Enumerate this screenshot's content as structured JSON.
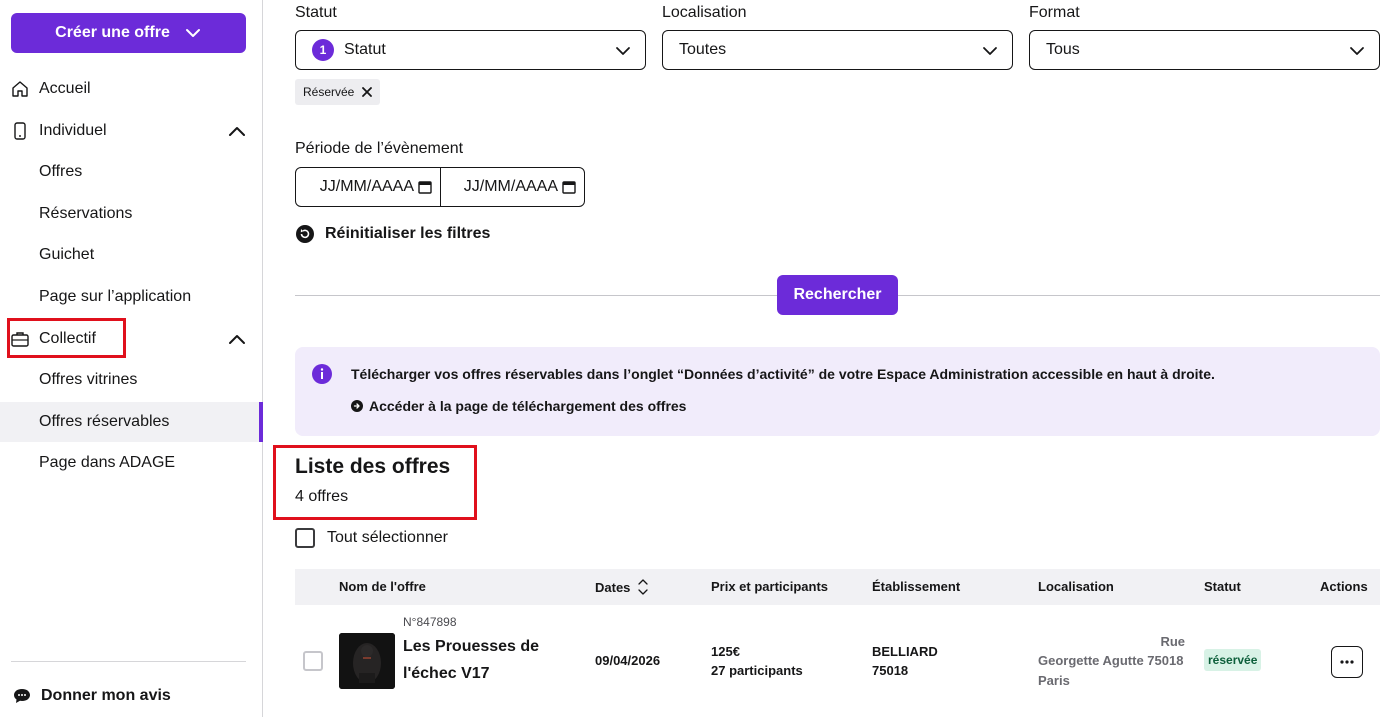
{
  "sidebar": {
    "create_button": "Créer une offre",
    "items": [
      {
        "label": "Accueil"
      },
      {
        "label": "Individuel"
      },
      {
        "label": "Offres"
      },
      {
        "label": "Réservations"
      },
      {
        "label": "Guichet"
      },
      {
        "label": "Page sur l’application"
      },
      {
        "label": "Collectif"
      },
      {
        "label": "Offres vitrines"
      },
      {
        "label": "Offres réservables"
      },
      {
        "label": "Page dans ADAGE"
      }
    ],
    "feedback": "Donner mon avis"
  },
  "filters": {
    "status_label": "Statut",
    "status_count": "1",
    "status_value": "Statut",
    "location_label": "Localisation",
    "location_value": "Toutes",
    "format_label": "Format",
    "format_value": "Tous",
    "active_tag": "Réservée",
    "period_label": "Période de l’évènement",
    "date_start_placeholder": "JJ/MM/AAAA",
    "date_end_placeholder": "JJ/MM/AAAA",
    "reset_label": "Réinitialiser les filtres",
    "search_button": "Rechercher"
  },
  "info_banner": {
    "message": "Télécharger vos offres réservables dans l’onglet “Données d’activité” de votre Espace Administration accessible en haut à droite.",
    "link": "Accéder à la page de téléchargement des offres"
  },
  "list": {
    "title": "Liste des offres",
    "count": "4 offres",
    "select_all": "Tout sélectionner",
    "columns": [
      "Nom de l'offre",
      "Dates",
      "Prix et participants",
      "Établissement",
      "Localisation",
      "Statut",
      "Actions"
    ],
    "rows": [
      {
        "number": "N°847898",
        "name": "Les Prouesses de l'échec V17",
        "date": "09/04/2026",
        "price": "125€",
        "participants": "27 participants",
        "establishment_line1": "BELLIARD",
        "establishment_line2": "75018",
        "location_line1": "Rue",
        "location_line2": "Georgette Agutte 75018",
        "location_line3": "Paris",
        "status": "réservée"
      }
    ]
  },
  "colors": {
    "accent": "#6c2bd9",
    "highlight_border": "#e0101c",
    "info_bg": "#f1ecfb",
    "status_bg": "#d8f2e6"
  }
}
